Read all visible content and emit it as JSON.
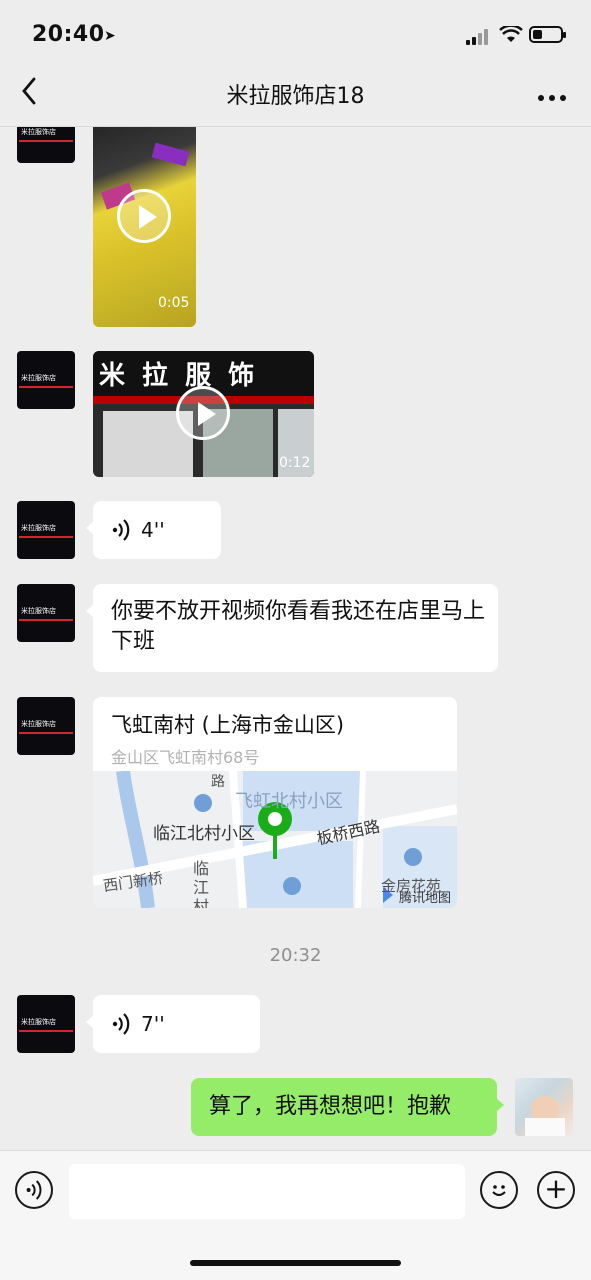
{
  "status_bar": {
    "time": "20:40",
    "location_icon": "location-arrow-icon",
    "signal_icon": "cellular-signal-icon",
    "wifi_icon": "wifi-icon",
    "battery_icon": "battery-icon"
  },
  "nav": {
    "title": "米拉服饰店18",
    "back_icon": "chevron-left-icon",
    "more_icon": "more-icon"
  },
  "avatar_text": "米拉服饰店",
  "messages": {
    "video1": {
      "duration": "0:05"
    },
    "video2": {
      "duration": "0:12",
      "sign_text": "米 拉 服 饰"
    },
    "voice1": {
      "duration": "4''"
    },
    "text1": {
      "text": "你要不放开视频你看看我还在店里马上下班"
    },
    "location": {
      "title": "飞虹南村 (上海市金山区)",
      "address": "金山区飞虹南村68号",
      "map_labels": [
        "飞虹北村小区",
        "临江北村小区",
        "板桥西路",
        "西门新桥",
        "临江村",
        "金房花苑"
      ],
      "map_attribution": "腾讯地图",
      "top_label": "路"
    },
    "timestamp": "20:32",
    "voice2": {
      "duration": "7''"
    },
    "mine_text": {
      "text": "算了，我再想想吧！抱歉"
    }
  },
  "input_bar": {
    "voice_icon": "voice-icon",
    "emoji_icon": "emoji-icon",
    "add_icon": "add-icon",
    "add_symbol": "+"
  },
  "colors": {
    "bg": "#ededed",
    "bubble_self": "#95ec69",
    "bubble_other": "#ffffff",
    "map_pin": "#1aad19",
    "avatar_stripe": "#d2262c"
  }
}
